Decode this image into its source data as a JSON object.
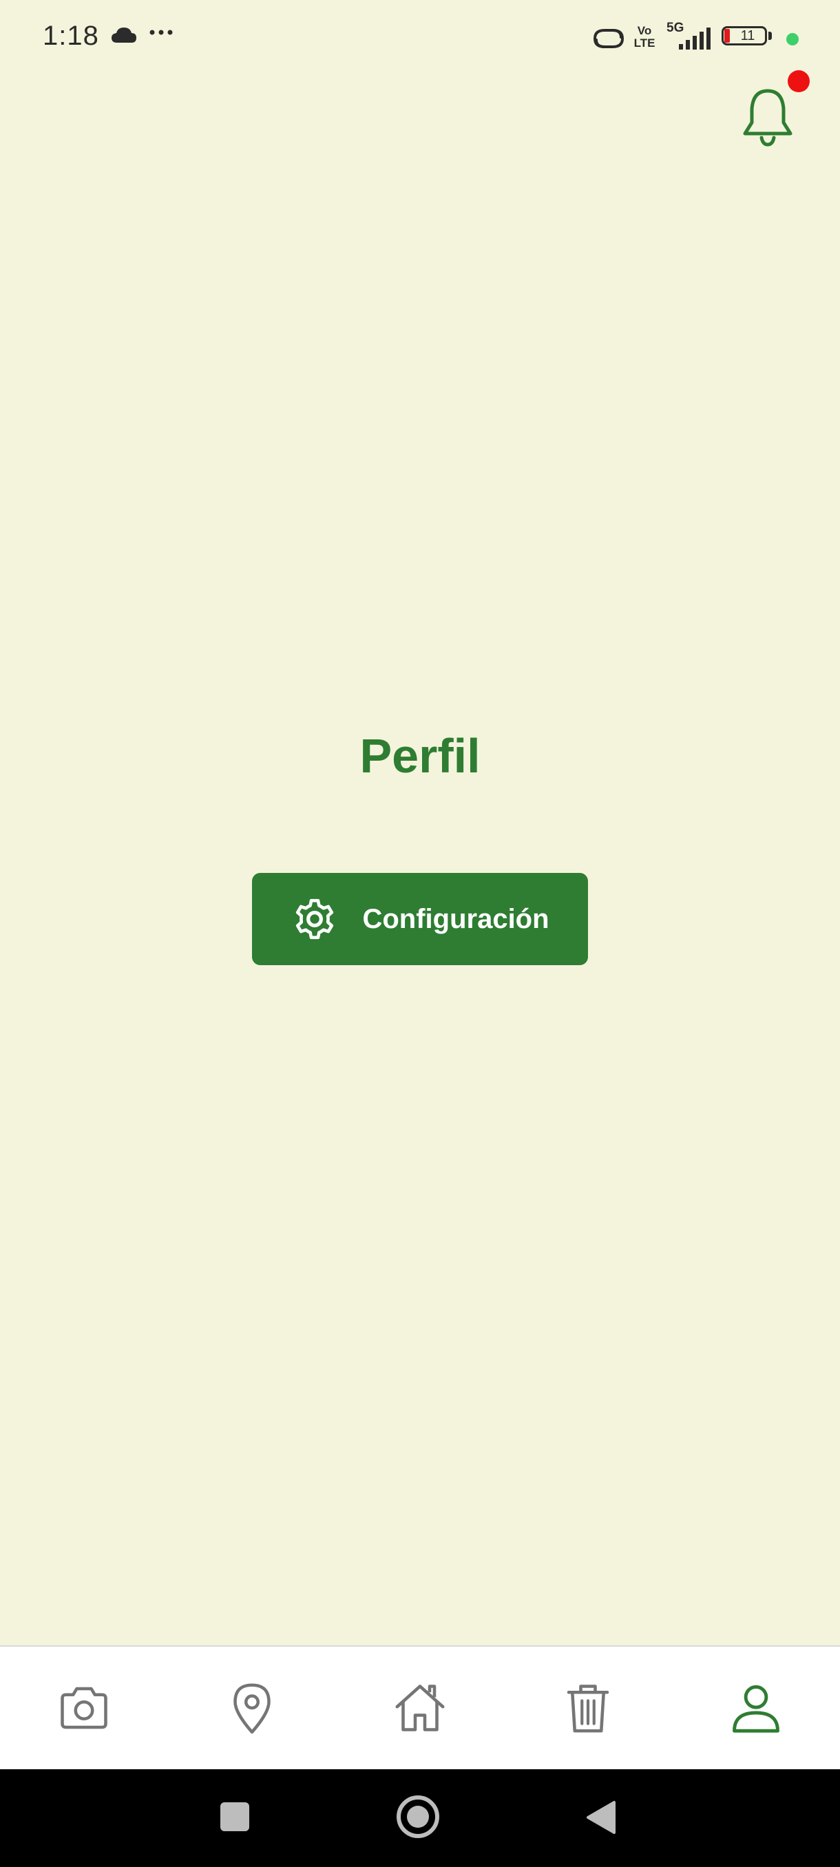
{
  "status_bar": {
    "time": "1:18",
    "volte": "Vo LTE",
    "network": "5G",
    "battery_level": "11"
  },
  "header": {
    "notification_icon": "bell-icon",
    "has_unread": true
  },
  "main": {
    "title": "Perfil",
    "settings_button_label": "Configuración",
    "settings_icon": "gear-icon"
  },
  "bottom_nav": {
    "items": [
      {
        "icon": "camera-icon",
        "active": false
      },
      {
        "icon": "location-pin-icon",
        "active": false
      },
      {
        "icon": "home-icon",
        "active": false
      },
      {
        "icon": "trash-icon",
        "active": false
      },
      {
        "icon": "user-icon",
        "active": true
      }
    ]
  },
  "colors": {
    "background": "#f4f4dc",
    "primary": "#2e7d32",
    "badge": "#ee1111",
    "inactive_icon": "#757575"
  }
}
